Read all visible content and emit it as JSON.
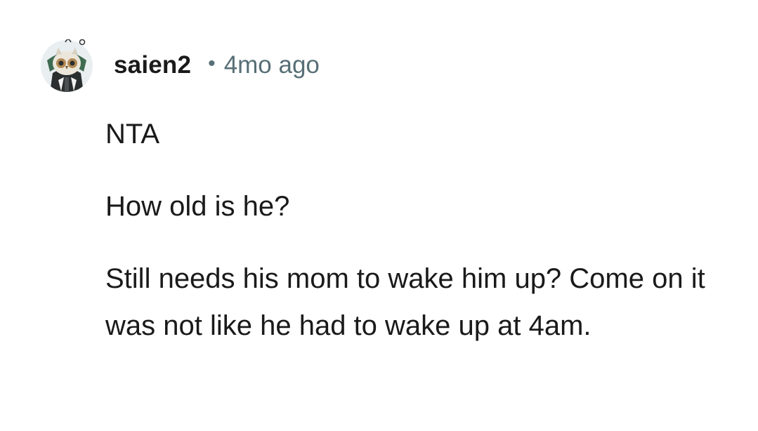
{
  "comment": {
    "username": "saien2",
    "separator": "•",
    "timestamp": "4mo ago",
    "paragraphs": [
      "NTA",
      "How old is he?",
      "Still needs his mom to wake him up? Come on it was not like he had to wake up at 4am."
    ]
  },
  "colors": {
    "text": "#1a1a1b",
    "meta": "#576f76",
    "avatar_bg": "#e9eef0"
  },
  "icons": {
    "avatar": "owl-avatar-icon"
  }
}
